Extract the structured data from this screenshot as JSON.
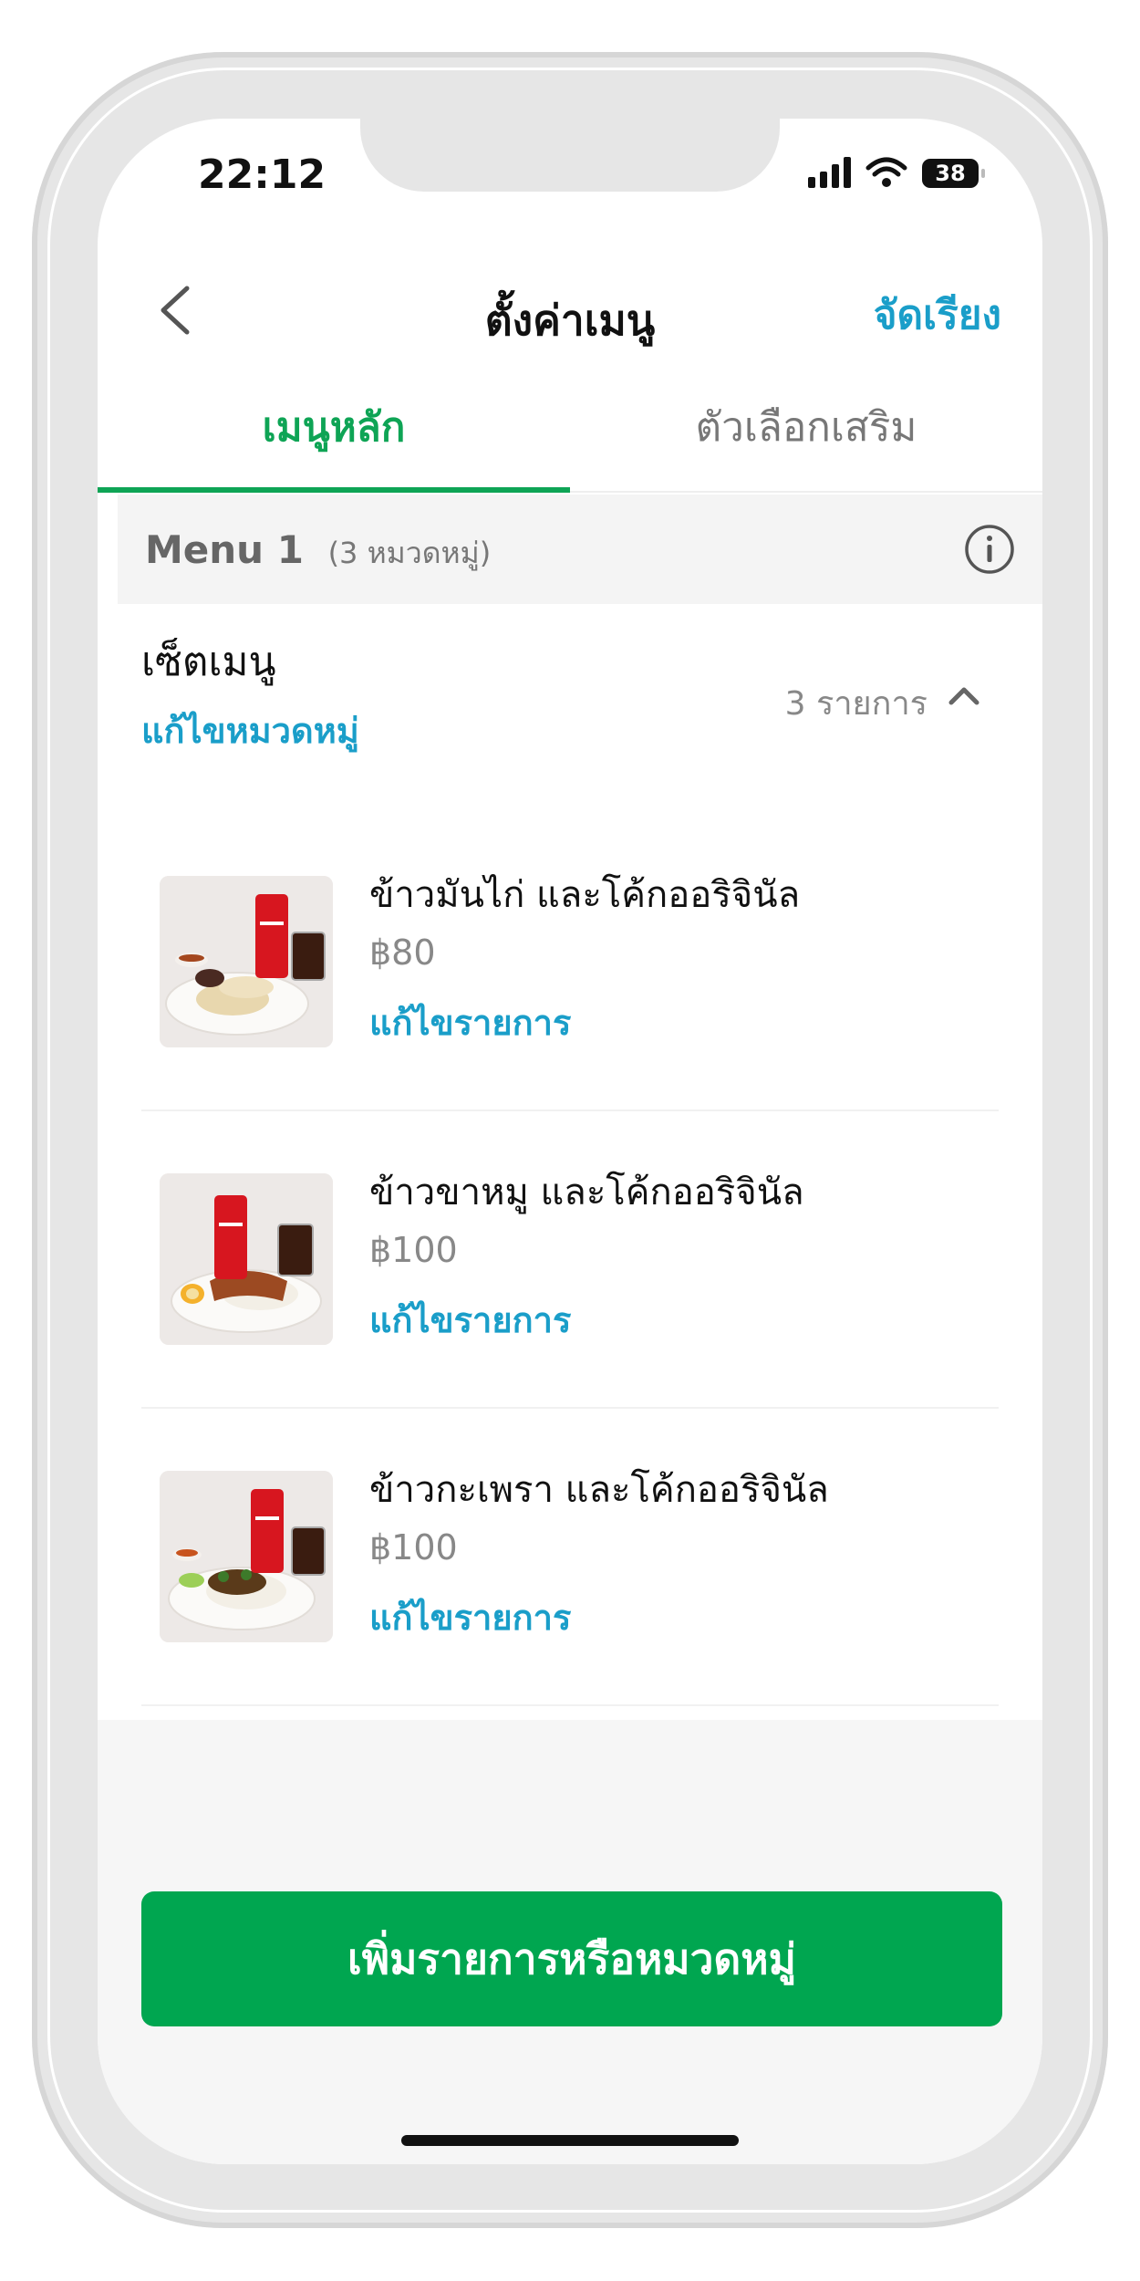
{
  "status_bar": {
    "time": "22:12",
    "battery": "38"
  },
  "header": {
    "title": "ตั้งค่าเมนู",
    "sort_label": "จัดเรียง"
  },
  "tabs": [
    {
      "label": "เมนูหลัก",
      "active": true
    },
    {
      "label": "ตัวเลือกเสริม",
      "active": false
    }
  ],
  "menu": {
    "name": "Menu 1",
    "category_count": "(3 หมวดหมู่)"
  },
  "category": {
    "title": "เซ็ตเมนู",
    "edit_label": "แก้ไขหมวดหมู่",
    "item_count": "3 รายการ"
  },
  "items": [
    {
      "name": "ข้าวมันไก่ และโค้กออริจินัล",
      "price": "฿80",
      "edit_label": "แก้ไขรายการ"
    },
    {
      "name": "ข้าวขาหมู และโค้กออริจินัล",
      "price": "฿100",
      "edit_label": "แก้ไขรายการ"
    },
    {
      "name": "ข้าวกะเพรา และโค้กออริจินัล",
      "price": "฿100",
      "edit_label": "แก้ไขรายการ"
    }
  ],
  "footer": {
    "add_button_label": "เพิ่มรายการหรือหมวดหมู่"
  },
  "colors": {
    "primary_green": "#00a650",
    "link_blue": "#1a9ec9"
  }
}
